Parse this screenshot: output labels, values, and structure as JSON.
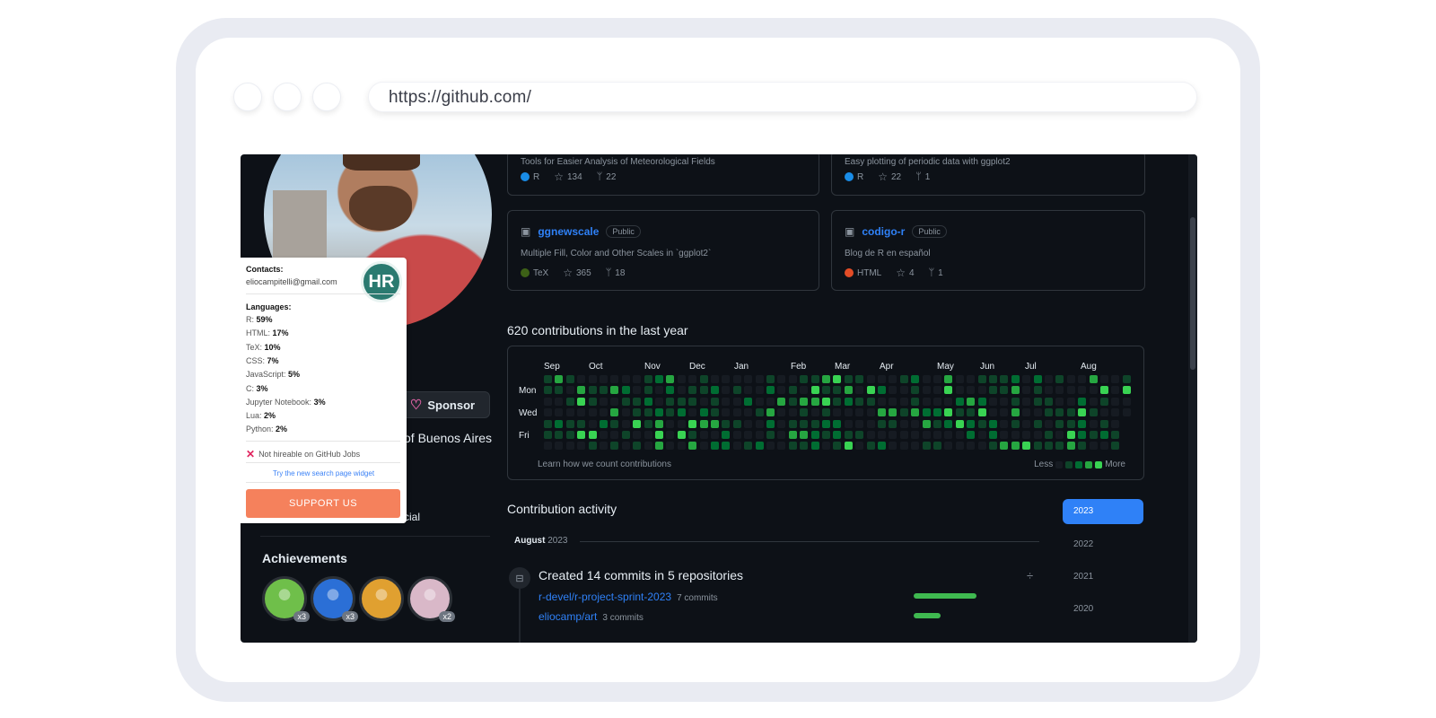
{
  "browser": {
    "url": "https://github.com/"
  },
  "profile": {
    "sponsor_label": "Sponsor",
    "location": "of Buenos Aires",
    "social_partial": "cial",
    "achievements_title": "Achievements",
    "badges": [
      {
        "name": "pull-shark-badge",
        "count": "x3",
        "color": "#6fbf4a"
      },
      {
        "name": "galaxy-brain-badge",
        "count": "x3",
        "color": "#2b6fd6"
      },
      {
        "name": "yolo-badge",
        "count": "",
        "color": "#e0a030"
      },
      {
        "name": "quickdraw-badge",
        "count": "x2",
        "color": "#d9b8c8"
      }
    ]
  },
  "extension": {
    "contacts_title": "Contacts:",
    "email": "eliocampitelli@gmail.com",
    "logo": "HR",
    "languages_title": "Languages:",
    "languages": [
      {
        "name": "R:",
        "pct": "59%"
      },
      {
        "name": "HTML:",
        "pct": "17%"
      },
      {
        "name": "TeX:",
        "pct": "10%"
      },
      {
        "name": "CSS:",
        "pct": "7%"
      },
      {
        "name": "JavaScript:",
        "pct": "5%"
      },
      {
        "name": "C:",
        "pct": "3%"
      },
      {
        "name": "Jupyter Notebook:",
        "pct": "3%"
      },
      {
        "name": "Lua:",
        "pct": "2%"
      },
      {
        "name": "Python:",
        "pct": "2%"
      }
    ],
    "not_hireable": "Not hireable on GitHub Jobs",
    "try_link": "Try the new search page widget",
    "support_label": "SUPPORT US"
  },
  "repos": [
    {
      "name": "",
      "visibility": "",
      "description": "Tools for Easier Analysis of Meteorological Fields",
      "lang": "R",
      "lang_color": "#198ce7",
      "stars": "134",
      "forks": "22"
    },
    {
      "name": "",
      "visibility": "",
      "description": "Easy plotting of periodic data with ggplot2",
      "lang": "R",
      "lang_color": "#198ce7",
      "stars": "22",
      "forks": "1"
    },
    {
      "name": "ggnewscale",
      "visibility": "Public",
      "description": "Multiple Fill, Color and Other Scales in `ggplot2`",
      "lang": "TeX",
      "lang_color": "#3d6117",
      "stars": "365",
      "forks": "18"
    },
    {
      "name": "codigo-r",
      "visibility": "Public",
      "description": "Blog de R en español",
      "lang": "HTML",
      "lang_color": "#e34c26",
      "stars": "4",
      "forks": "1"
    }
  ],
  "contributions": {
    "title": "620 contributions in the last year",
    "months": [
      "Sep",
      "Oct",
      "Nov",
      "Dec",
      "Jan",
      "Feb",
      "Mar",
      "Apr",
      "May",
      "Jun",
      "Jul",
      "Aug"
    ],
    "days": [
      "Mon",
      "Wed",
      "Fri"
    ],
    "learn": "Learn how we count contributions",
    "less": "Less",
    "more": "More",
    "level_colors": [
      "#161b22",
      "#0e4429",
      "#006d32",
      "#26a641",
      "#39d353"
    ]
  },
  "activity": {
    "title": "Contribution activity",
    "years": [
      "2023",
      "2022",
      "2021",
      "2020"
    ],
    "selected_year": "2023",
    "month": "August",
    "month_year": "2023",
    "event_title": "Created 14 commits in 5 repositories",
    "commits": [
      {
        "repo": "r-devel/r-project-sprint-2023",
        "count": "7 commits",
        "share": 1.0
      },
      {
        "repo": "eliocamp/art",
        "count": "3 commits",
        "share": 0.43
      }
    ]
  }
}
